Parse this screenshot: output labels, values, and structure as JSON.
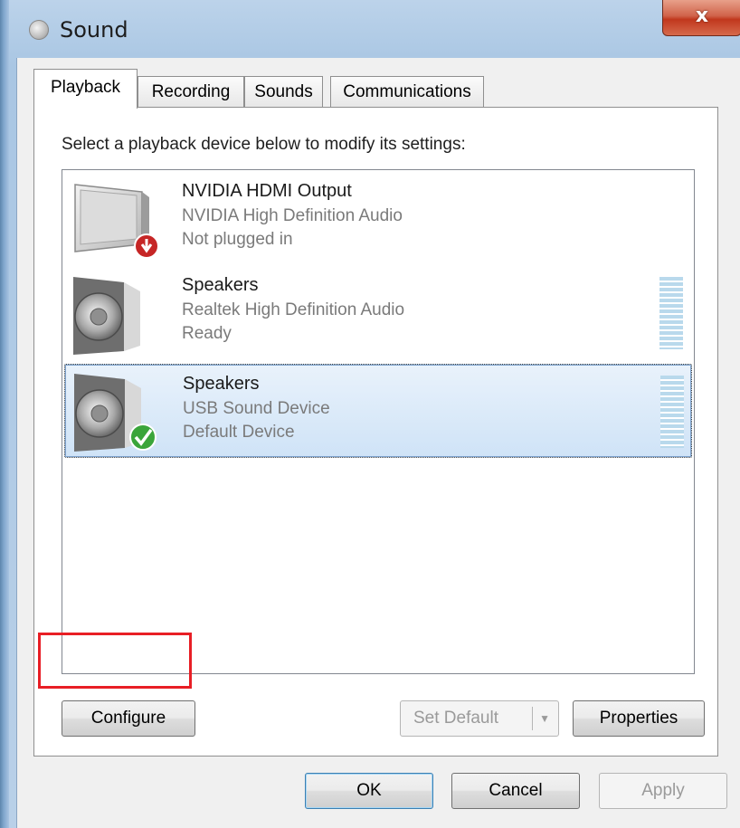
{
  "window": {
    "title": "Sound",
    "close_label": "x"
  },
  "tabs": [
    {
      "label": "Playback",
      "active": true
    },
    {
      "label": "Recording",
      "active": false
    },
    {
      "label": "Sounds",
      "active": false
    },
    {
      "label": "Communications",
      "active": false
    }
  ],
  "playback": {
    "instructions": "Select a playback device below to modify its settings:",
    "devices": [
      {
        "name": "NVIDIA HDMI Output",
        "description": "NVIDIA High Definition Audio",
        "status": "Not plugged in",
        "icon": "monitor-unplugged-icon"
      },
      {
        "name": "Speakers",
        "description": "Realtek High Definition Audio",
        "status": "Ready",
        "icon": "speaker-icon"
      },
      {
        "name": "Speakers",
        "description": "USB Sound Device",
        "status": "Default Device",
        "icon": "speaker-default-icon",
        "selected": true
      }
    ]
  },
  "buttons": {
    "configure": "Configure",
    "set_default": "Set Default",
    "properties": "Properties",
    "ok": "OK",
    "cancel": "Cancel",
    "apply": "Apply"
  },
  "colors": {
    "highlight": "#e81e25",
    "selection": "#cfe3f7",
    "close": "#c1371d"
  }
}
